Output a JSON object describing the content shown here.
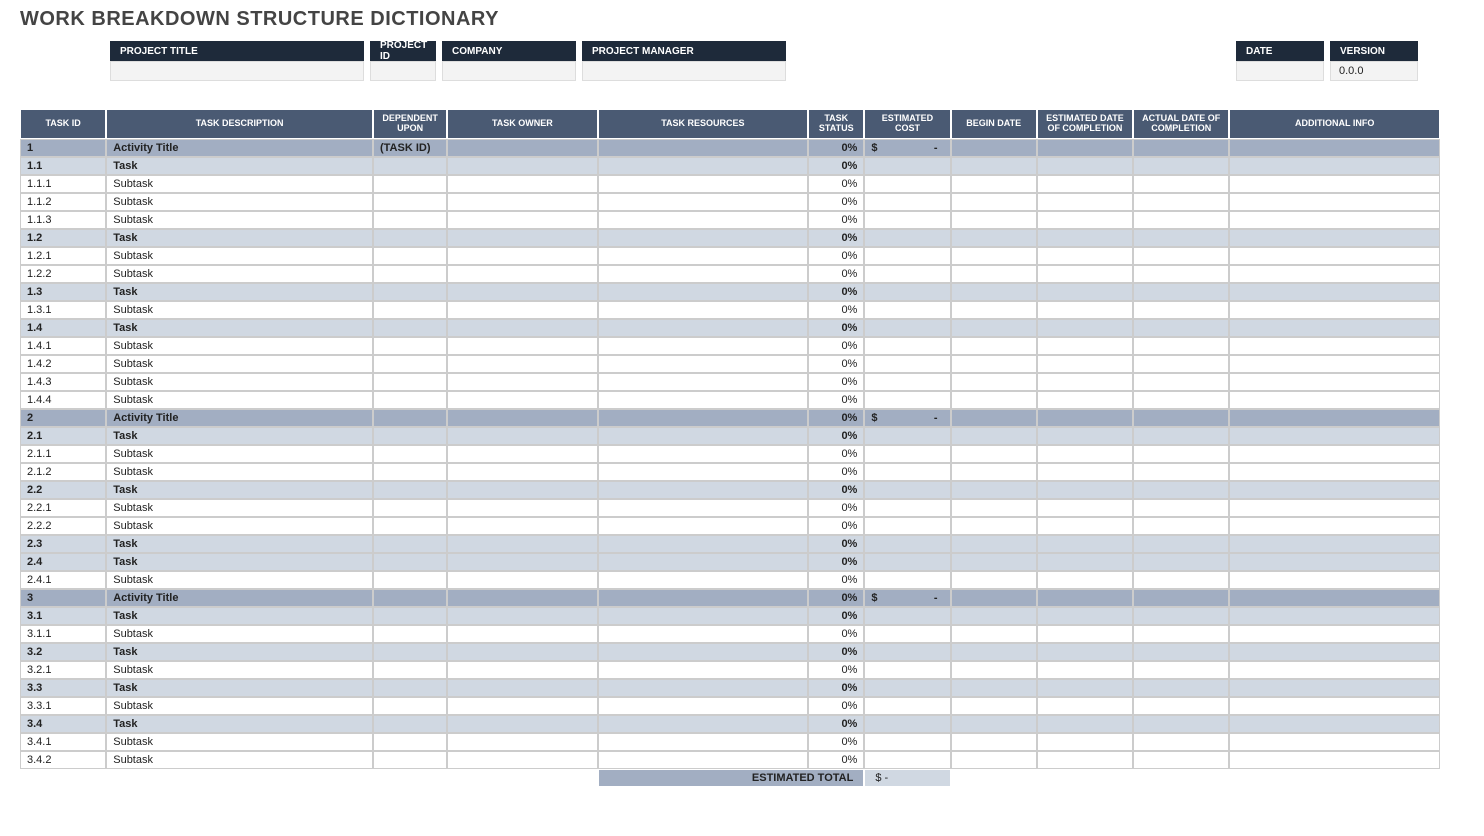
{
  "title": "WORK BREAKDOWN STRUCTURE DICTIONARY",
  "meta": {
    "labels": {
      "project_title": "PROJECT TITLE",
      "project_id": "PROJECT ID",
      "company": "COMPANY",
      "project_manager": "PROJECT MANAGER",
      "date": "DATE",
      "version": "VERSION"
    },
    "values": {
      "project_title": "",
      "project_id": "",
      "company": "",
      "project_manager": "",
      "date": "",
      "version": "0.0.0"
    }
  },
  "columns": {
    "task_id": "TASK ID",
    "task_description": "TASK DESCRIPTION",
    "dependent_upon": "DEPENDENT UPON",
    "task_owner": "TASK OWNER",
    "task_resources": "TASK RESOURCES",
    "task_status": "TASK STATUS",
    "estimated_cost": "ESTIMATED COST",
    "begin_date": "BEGIN DATE",
    "est_completion": "ESTIMATED DATE OF COMPLETION",
    "actual_completion": "ACTUAL DATE OF COMPLETION",
    "additional_info": "ADDITIONAL INFO"
  },
  "rows": [
    {
      "level": "activity",
      "id": "1",
      "desc": "Activity Title",
      "dep": "(TASK ID)",
      "status": "0%",
      "cost_sym": "$",
      "cost_val": "-"
    },
    {
      "level": "task",
      "id": "1.1",
      "desc": "Task",
      "status": "0%"
    },
    {
      "level": "subtask",
      "id": "1.1.1",
      "desc": "Subtask",
      "status": "0%"
    },
    {
      "level": "subtask",
      "id": "1.1.2",
      "desc": "Subtask",
      "status": "0%"
    },
    {
      "level": "subtask",
      "id": "1.1.3",
      "desc": "Subtask",
      "status": "0%"
    },
    {
      "level": "task",
      "id": "1.2",
      "desc": "Task",
      "status": "0%"
    },
    {
      "level": "subtask",
      "id": "1.2.1",
      "desc": "Subtask",
      "status": "0%"
    },
    {
      "level": "subtask",
      "id": "1.2.2",
      "desc": "Subtask",
      "status": "0%"
    },
    {
      "level": "task",
      "id": "1.3",
      "desc": "Task",
      "status": "0%"
    },
    {
      "level": "subtask",
      "id": "1.3.1",
      "desc": "Subtask",
      "status": "0%"
    },
    {
      "level": "task",
      "id": "1.4",
      "desc": "Task",
      "status": "0%"
    },
    {
      "level": "subtask",
      "id": "1.4.1",
      "desc": "Subtask",
      "status": "0%"
    },
    {
      "level": "subtask",
      "id": "1.4.2",
      "desc": "Subtask",
      "status": "0%"
    },
    {
      "level": "subtask",
      "id": "1.4.3",
      "desc": "Subtask",
      "status": "0%"
    },
    {
      "level": "subtask",
      "id": "1.4.4",
      "desc": "Subtask",
      "status": "0%"
    },
    {
      "level": "activity",
      "id": "2",
      "desc": "Activity Title",
      "status": "0%",
      "cost_sym": "$",
      "cost_val": "-"
    },
    {
      "level": "task",
      "id": "2.1",
      "desc": "Task",
      "status": "0%"
    },
    {
      "level": "subtask",
      "id": "2.1.1",
      "desc": "Subtask",
      "status": "0%"
    },
    {
      "level": "subtask",
      "id": "2.1.2",
      "desc": "Subtask",
      "status": "0%"
    },
    {
      "level": "task",
      "id": "2.2",
      "desc": "Task",
      "status": "0%"
    },
    {
      "level": "subtask",
      "id": "2.2.1",
      "desc": "Subtask",
      "status": "0%"
    },
    {
      "level": "subtask",
      "id": "2.2.2",
      "desc": "Subtask",
      "status": "0%"
    },
    {
      "level": "task",
      "id": "2.3",
      "desc": "Task",
      "status": "0%"
    },
    {
      "level": "task",
      "id": "2.4",
      "desc": "Task",
      "status": "0%"
    },
    {
      "level": "subtask",
      "id": "2.4.1",
      "desc": "Subtask",
      "status": "0%"
    },
    {
      "level": "activity",
      "id": "3",
      "desc": "Activity Title",
      "status": "0%",
      "cost_sym": "$",
      "cost_val": "-"
    },
    {
      "level": "task",
      "id": "3.1",
      "desc": "Task",
      "status": "0%"
    },
    {
      "level": "subtask",
      "id": "3.1.1",
      "desc": "Subtask",
      "status": "0%"
    },
    {
      "level": "task",
      "id": "3.2",
      "desc": "Task",
      "status": "0%"
    },
    {
      "level": "subtask",
      "id": "3.2.1",
      "desc": "Subtask",
      "status": "0%"
    },
    {
      "level": "task",
      "id": "3.3",
      "desc": "Task",
      "status": "0%"
    },
    {
      "level": "subtask",
      "id": "3.3.1",
      "desc": "Subtask",
      "status": "0%"
    },
    {
      "level": "task",
      "id": "3.4",
      "desc": "Task",
      "status": "0%"
    },
    {
      "level": "subtask",
      "id": "3.4.1",
      "desc": "Subtask",
      "status": "0%"
    },
    {
      "level": "subtask",
      "id": "3.4.2",
      "desc": "Subtask",
      "status": "0%"
    }
  ],
  "total": {
    "label": "ESTIMATED TOTAL",
    "sym": "$",
    "val": "-"
  }
}
